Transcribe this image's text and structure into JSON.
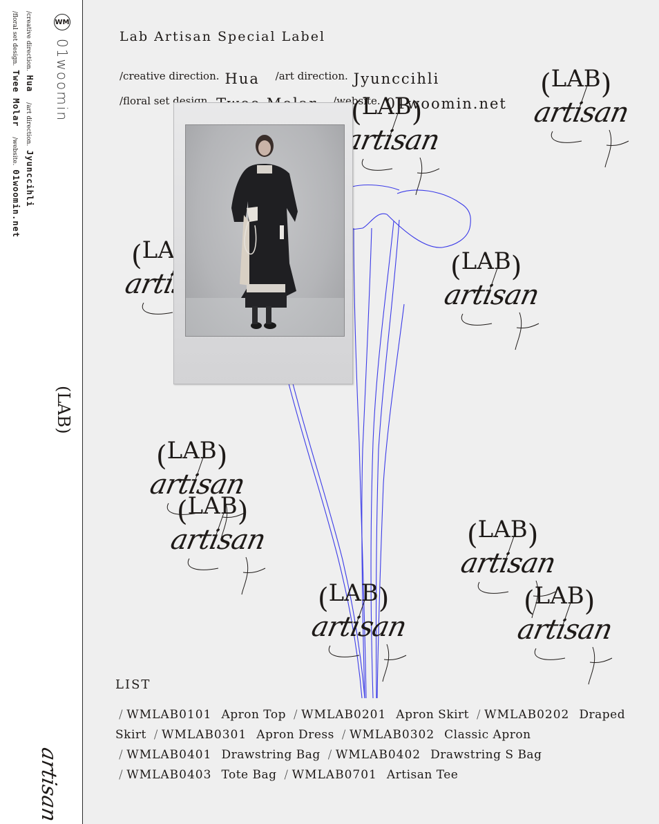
{
  "brand": {
    "name": "01woomin",
    "logo_icon": "wm-circle-logo"
  },
  "sidebar": {
    "credits": [
      {
        "label": "/creative direction.",
        "value": "Hua"
      },
      {
        "label": "/art direction.",
        "value": "Jyunccihli"
      },
      {
        "label": "/floral set design.",
        "value": "Twee Molar"
      },
      {
        "label": "/website.",
        "value": "01woomin.net"
      }
    ],
    "lab_text": "(LAB)",
    "artisan_text": "artisan"
  },
  "header": {
    "title": "Lab Artisan Special Label"
  },
  "credits": [
    {
      "label": "/creative direction.",
      "value": "Hua"
    },
    {
      "label": "/art direction.",
      "value": "Jyunccihli"
    },
    {
      "label": "/floral set design.",
      "value": "Twee Molar"
    },
    {
      "label": "/website.",
      "value": "01woomin.net"
    }
  ],
  "logo_mark": {
    "lab": "LAB",
    "open": "(",
    "close": ")",
    "artisan": "artisan"
  },
  "colors": {
    "background": "#efefef",
    "ink": "#1e1a18",
    "iris_line": "#3a3ae8"
  },
  "list": {
    "title": "LIST",
    "items": [
      {
        "code": "WMLAB0101",
        "name": "Apron Top"
      },
      {
        "code": "WMLAB0201",
        "name": "Apron Skirt"
      },
      {
        "code": "WMLAB0202",
        "name": "Draped Skirt"
      },
      {
        "code": "WMLAB0301",
        "name": "Apron Dress"
      },
      {
        "code": "WMLAB0302",
        "name": "Classic Apron"
      },
      {
        "code": "WMLAB0401",
        "name": "Drawstring Bag"
      },
      {
        "code": "WMLAB0402",
        "name": "Drawstring S Bag"
      },
      {
        "code": "WMLAB0403",
        "name": "Tote Bag"
      },
      {
        "code": "WMLAB0701",
        "name": "Artisan Tee"
      }
    ],
    "separator": "/"
  }
}
